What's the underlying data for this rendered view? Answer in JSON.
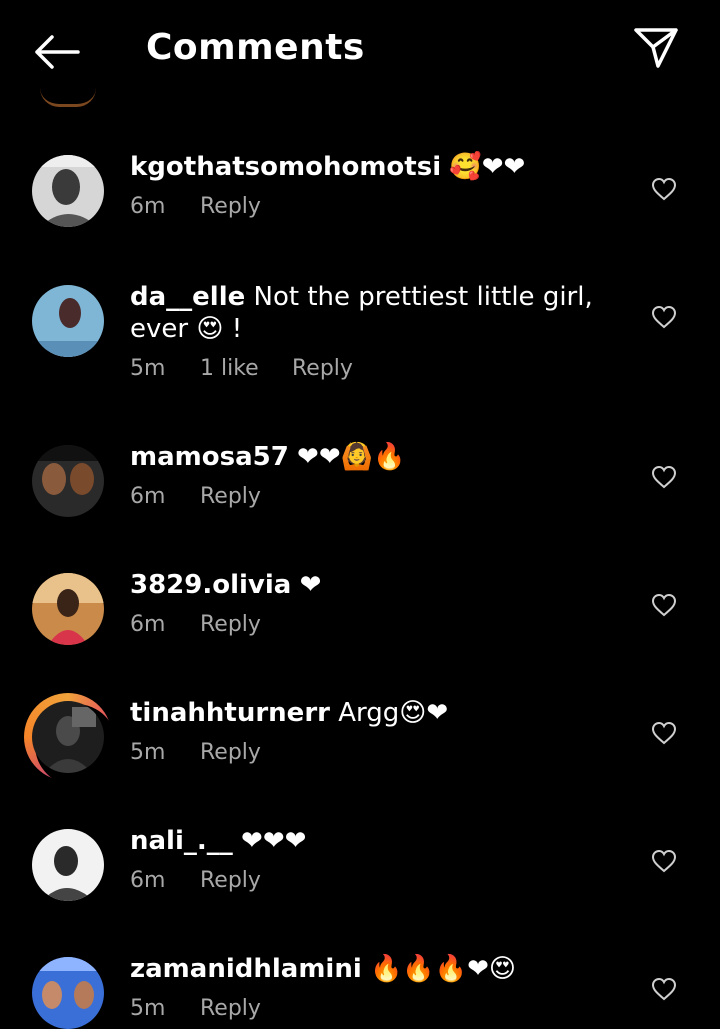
{
  "header": {
    "title": "Comments"
  },
  "comments": [
    {
      "username": "kgothatsomohomotsi",
      "text": " 🥰❤❤",
      "time": "6m",
      "likes": "",
      "reply": "Reply"
    },
    {
      "username": "da__elle",
      "text": " Not the prettiest little girl, ever 😍 !",
      "time": "5m",
      "likes": "1 like",
      "reply": "Reply"
    },
    {
      "username": "mamosa57",
      "text": " ❤❤🙆🔥",
      "time": "6m",
      "likes": "",
      "reply": "Reply"
    },
    {
      "username": "3829.olivia",
      "text": " ❤",
      "time": "6m",
      "likes": "",
      "reply": "Reply"
    },
    {
      "username": "tinahhturnerr",
      "text": " Argg😍❤",
      "time": "5m",
      "likes": "",
      "reply": "Reply"
    },
    {
      "username": "nali_.__",
      "text": " ❤❤❤",
      "time": "6m",
      "likes": "",
      "reply": "Reply"
    },
    {
      "username": "zamanidhlamini",
      "text": " 🔥🔥🔥❤😍",
      "time": "5m",
      "likes": "",
      "reply": "Reply"
    }
  ],
  "colors": {
    "background": "#000000",
    "text": "#ffffff",
    "meta": "#a8a8a8",
    "story_ring": "#e2336b"
  },
  "icons": {
    "back": "arrow-left-icon",
    "share": "paper-plane-icon",
    "like": "heart-outline-icon"
  }
}
